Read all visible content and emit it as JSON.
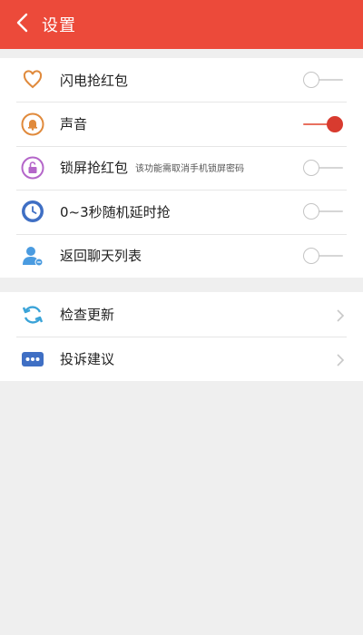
{
  "header": {
    "title": "设置",
    "back_icon": "chevron-left-icon",
    "background": "#ec4a3a"
  },
  "settings": [
    {
      "label": "闪电抢红包",
      "note": "",
      "icon": "heart-icon",
      "enabled": false
    },
    {
      "label": "声音",
      "note": "",
      "icon": "bell-icon",
      "enabled": true
    },
    {
      "label": "锁屏抢红包",
      "note": "该功能需取消手机锁屏密码",
      "icon": "lock-icon",
      "enabled": false
    },
    {
      "label": "0~3秒随机延时抢",
      "note": "",
      "icon": "clock-icon",
      "enabled": false
    },
    {
      "label": "返回聊天列表",
      "note": "",
      "icon": "user-icon",
      "enabled": false
    }
  ],
  "links": [
    {
      "label": "检查更新",
      "icon": "refresh-icon"
    },
    {
      "label": "投诉建议",
      "icon": "chat-dots-icon"
    }
  ],
  "colors": {
    "accent": "#d83b2f",
    "background": "#efefef"
  }
}
